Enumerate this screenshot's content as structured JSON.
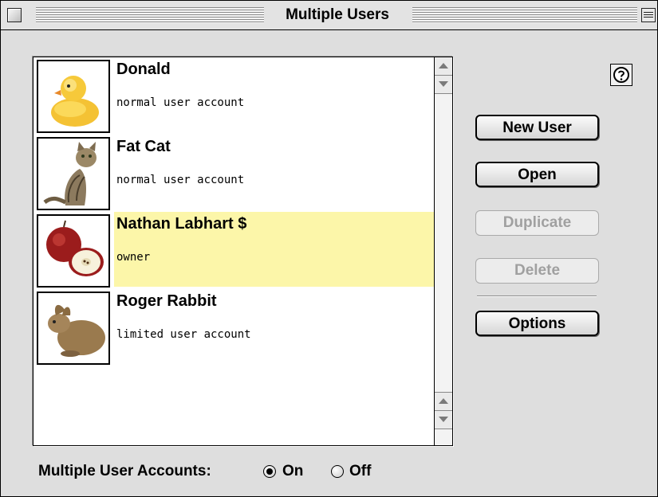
{
  "window": {
    "title": "Multiple Users"
  },
  "users": [
    {
      "name": "Donald",
      "type": "normal user account",
      "picture": "rubber-duck"
    },
    {
      "name": "Fat Cat",
      "type": "normal user account",
      "picture": "tabby-cat"
    },
    {
      "name": "Nathan Labhart $",
      "type": "owner",
      "picture": "apple",
      "selected": true
    },
    {
      "name": "Roger Rabbit",
      "type": "limited user account",
      "picture": "rabbit"
    }
  ],
  "buttons": {
    "new_user": "New User",
    "open": "Open",
    "duplicate": "Duplicate",
    "delete": "Delete",
    "options": "Options"
  },
  "footer": {
    "label": "Multiple User Accounts:",
    "on_label": "On",
    "off_label": "Off",
    "selected": "On"
  },
  "colors": {
    "selection": "#fcf6a9"
  }
}
